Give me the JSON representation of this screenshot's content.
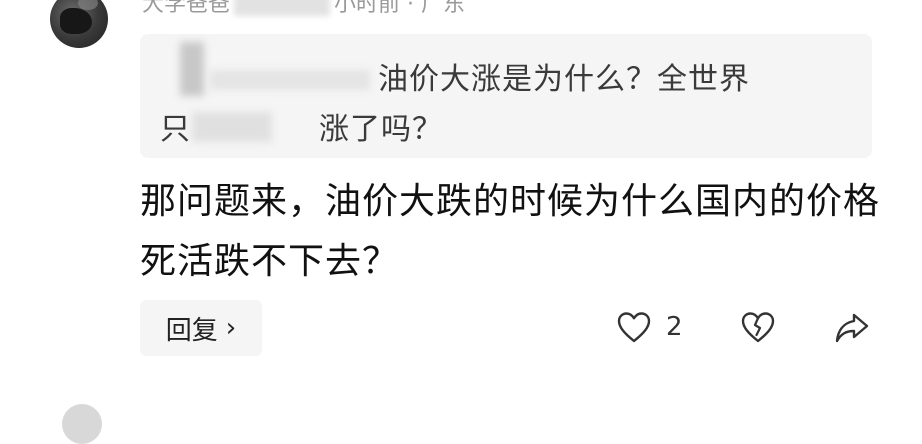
{
  "comment": {
    "meta_left": "大学爸爸",
    "meta_right": "小时前 · 广东",
    "quoted": {
      "line1": "油价大涨是为什么？全世界",
      "line2_prefix": "只",
      "line2_suffix": "涨了吗？"
    },
    "text": "那问题来，油价大跌的时候为什么国内的价格死活跌不下去？",
    "reply_label": "回复",
    "reply_chevron": "›",
    "like_count": "2"
  },
  "icons": {
    "like": "heart-outline-icon",
    "dislike": "broken-heart-icon",
    "share": "share-arrow-icon"
  },
  "colors": {
    "quote_bg": "#f5f5f5",
    "meta_text": "#9a9a9a",
    "icon_stroke": "#333333"
  }
}
